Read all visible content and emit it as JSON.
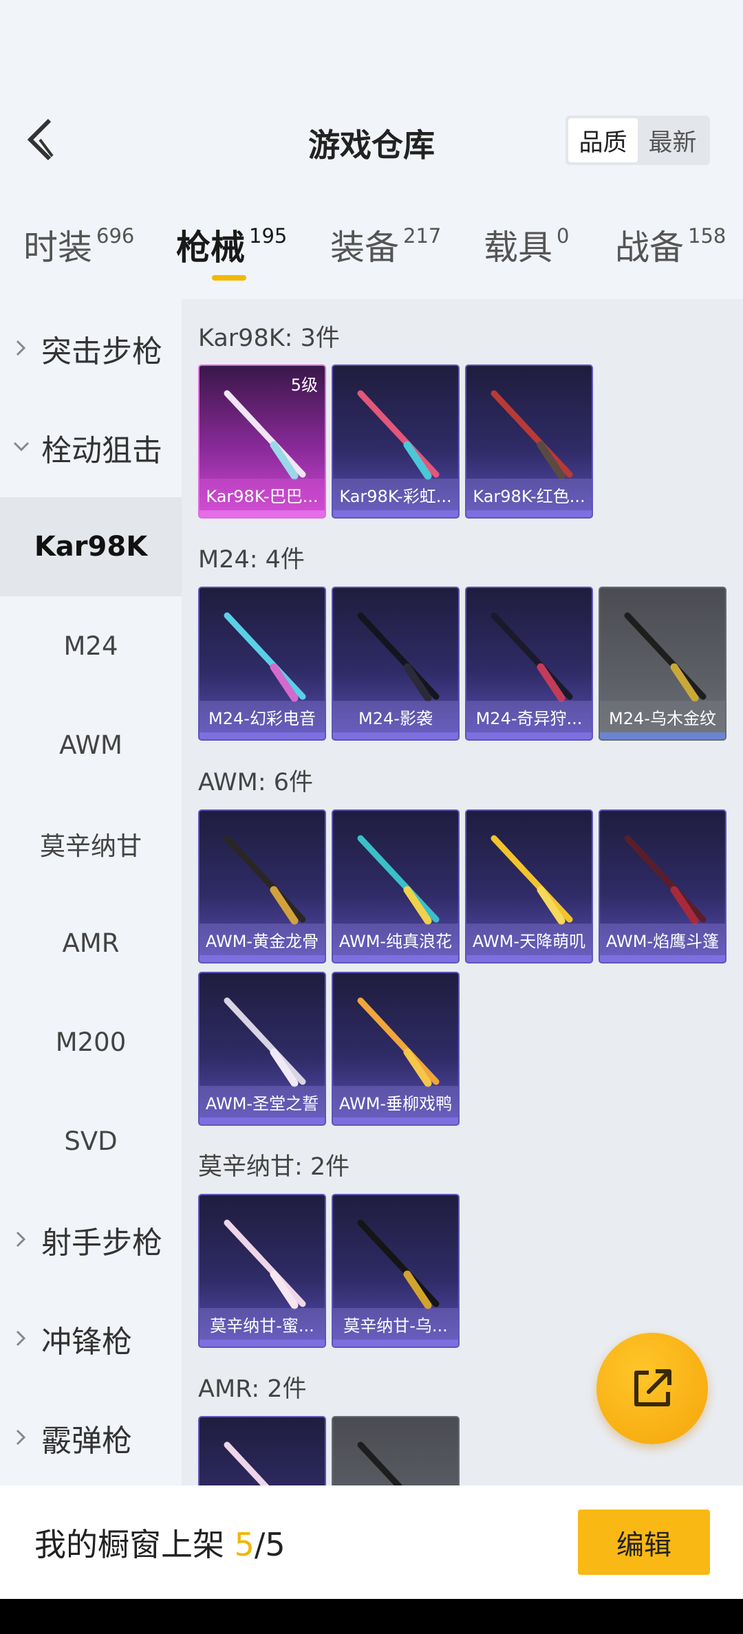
{
  "header": {
    "title": "游戏仓库",
    "sort_options": [
      "品质",
      "最新"
    ]
  },
  "tabs": [
    {
      "label": "时装",
      "count": "696"
    },
    {
      "label": "枪械",
      "count": "195"
    },
    {
      "label": "装备",
      "count": "217"
    },
    {
      "label": "载具",
      "count": "0"
    },
    {
      "label": "战备",
      "count": "158"
    }
  ],
  "sidebar": {
    "groups": [
      {
        "label": "突击步枪",
        "expanded": false
      },
      {
        "label": "栓动狙击",
        "expanded": true
      },
      {
        "label": "射手步枪",
        "expanded": false
      },
      {
        "label": "冲锋枪",
        "expanded": false
      },
      {
        "label": "霰弹枪",
        "expanded": false
      }
    ],
    "subitems": [
      "Kar98K",
      "M24",
      "AWM",
      "莫辛纳甘",
      "AMR",
      "M200",
      "SVD"
    ]
  },
  "sections": [
    {
      "title": "Kar98K: 3件",
      "items": [
        {
          "name": "Kar98K-巴巴...",
          "level": "5级"
        },
        {
          "name": "Kar98K-彩虹..."
        },
        {
          "name": "Kar98K-红色..."
        }
      ]
    },
    {
      "title": "M24: 4件",
      "items": [
        {
          "name": "M24-幻彩电音"
        },
        {
          "name": "M24-影袭"
        },
        {
          "name": "M24-奇异狩..."
        },
        {
          "name": "M24-乌木金纹"
        }
      ]
    },
    {
      "title": "AWM: 6件",
      "items": [
        {
          "name": "AWM-黄金龙骨"
        },
        {
          "name": "AWM-纯真浪花"
        },
        {
          "name": "AWM-天降萌叽"
        },
        {
          "name": "AWM-焰鹰斗篷"
        },
        {
          "name": "AWM-圣堂之誓"
        },
        {
          "name": "AWM-垂柳戏鸭"
        }
      ]
    },
    {
      "title": "莫辛纳甘: 2件",
      "items": [
        {
          "name": "莫辛纳甘-蜜..."
        },
        {
          "name": "莫辛纳甘-乌..."
        }
      ]
    },
    {
      "title": "AMR: 2件",
      "items": []
    }
  ],
  "showcase": {
    "label": "我的橱窗上架",
    "current": "5",
    "total": "/5"
  },
  "edit_label": "编辑",
  "colors": {
    "accent": "#f5b400",
    "card_purple": "#2f2b66",
    "card_pink": "#d04bd4",
    "card_gray": "#5d5f66"
  }
}
